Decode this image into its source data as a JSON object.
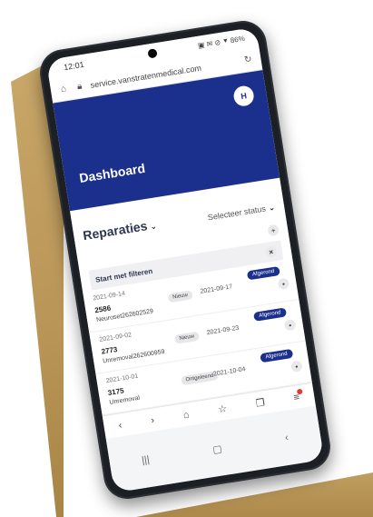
{
  "status_bar": {
    "time": "12:01",
    "icons": "▣ ✉ ⊘ ⯆ 86%"
  },
  "browser": {
    "url": "service.vanstratenmedical.com"
  },
  "header": {
    "title": "Dashboard",
    "avatar_initial": "H"
  },
  "filters": {
    "type_label": "Reparaties",
    "status_label": "Selecteer status",
    "start_label": "Start met filteren"
  },
  "rows": [
    {
      "date": "2021-09-14",
      "id": "2586",
      "desc": "Neuroset262602529",
      "badge": "Nieuw",
      "date2": "2021-09-17",
      "status": "Afgerond"
    },
    {
      "date": "2021-09-02",
      "id": "2773",
      "desc": "Unremoval262600959",
      "badge": "Nieuw",
      "date2": "2021-09-23",
      "status": "Afgerond"
    },
    {
      "date": "2021-10-01",
      "id": "3175",
      "desc": "Unremoval",
      "badge": "Ontgeleend",
      "date2": "2021-10-04",
      "status": "Afgerond"
    }
  ],
  "colors": {
    "header": "#1b2f8c",
    "status_badge": "#1b2f8c"
  },
  "icons": {
    "back": "back-icon",
    "forward": "forward-icon",
    "home": "home-icon",
    "star": "star-icon",
    "tabs": "tabs-icon",
    "menu": "menu-icon"
  }
}
